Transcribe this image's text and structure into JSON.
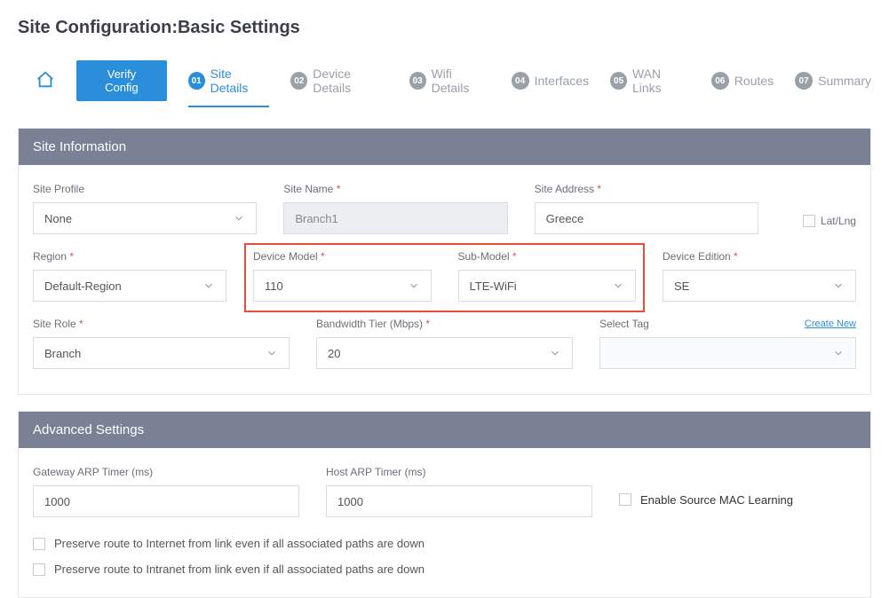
{
  "title": "Site Configuration:Basic Settings",
  "actions": {
    "verify": "Verify Config"
  },
  "steps": [
    {
      "num": "01",
      "label": "Site Details"
    },
    {
      "num": "02",
      "label": "Device Details"
    },
    {
      "num": "03",
      "label": "Wifi Details"
    },
    {
      "num": "04",
      "label": "Interfaces"
    },
    {
      "num": "05",
      "label": "WAN Links"
    },
    {
      "num": "06",
      "label": "Routes"
    },
    {
      "num": "07",
      "label": "Summary"
    }
  ],
  "panels": {
    "siteInfo": "Site Information",
    "advanced": "Advanced Settings"
  },
  "fields": {
    "siteProfile": {
      "label": "Site Profile",
      "value": "None"
    },
    "siteName": {
      "label": "Site Name",
      "value": "Branch1"
    },
    "siteAddress": {
      "label": "Site Address",
      "value": "Greece"
    },
    "latLng": {
      "label": "Lat/Lng"
    },
    "region": {
      "label": "Region",
      "value": "Default-Region"
    },
    "deviceModel": {
      "label": "Device Model",
      "value": "110"
    },
    "subModel": {
      "label": "Sub-Model",
      "value": "LTE-WiFi"
    },
    "deviceEdition": {
      "label": "Device Edition",
      "value": "SE"
    },
    "siteRole": {
      "label": "Site Role",
      "value": "Branch"
    },
    "bandwidthTier": {
      "label": "Bandwidth Tier (Mbps)",
      "value": "20"
    },
    "selectTag": {
      "label": "Select Tag",
      "createNew": "Create New"
    }
  },
  "advanced": {
    "gatewayArp": {
      "label": "Gateway ARP Timer (ms)",
      "value": "1000"
    },
    "hostArp": {
      "label": "Host ARP Timer (ms)",
      "value": "1000"
    },
    "enableMac": "Enable Source MAC Learning",
    "preserveInternet": "Preserve route to Internet from link even if all associated paths are down",
    "preserveIntranet": "Preserve route to Intranet from link even if all associated paths are down"
  }
}
